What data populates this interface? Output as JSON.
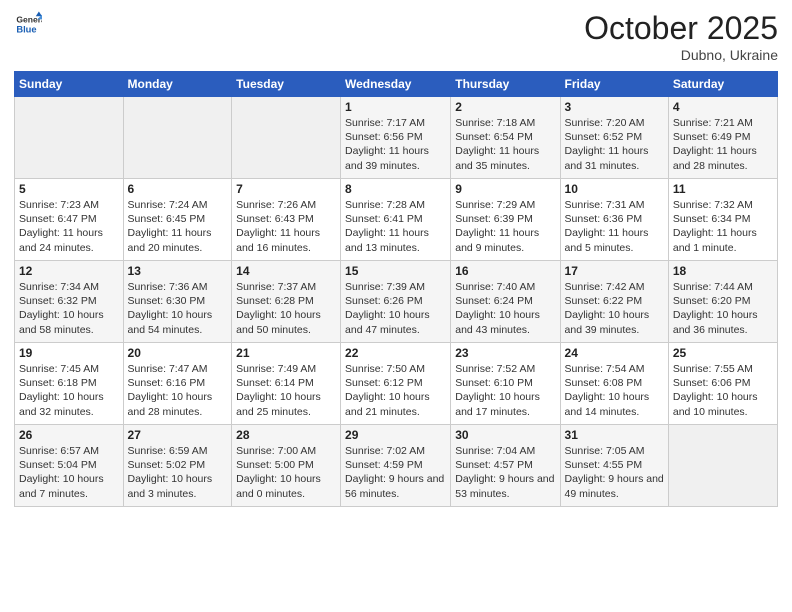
{
  "header": {
    "logo_general": "General",
    "logo_blue": "Blue",
    "month_title": "October 2025",
    "location": "Dubno, Ukraine"
  },
  "days_of_week": [
    "Sunday",
    "Monday",
    "Tuesday",
    "Wednesday",
    "Thursday",
    "Friday",
    "Saturday"
  ],
  "weeks": [
    [
      {
        "day": "",
        "info": ""
      },
      {
        "day": "",
        "info": ""
      },
      {
        "day": "",
        "info": ""
      },
      {
        "day": "1",
        "info": "Sunrise: 7:17 AM\nSunset: 6:56 PM\nDaylight: 11 hours and 39 minutes."
      },
      {
        "day": "2",
        "info": "Sunrise: 7:18 AM\nSunset: 6:54 PM\nDaylight: 11 hours and 35 minutes."
      },
      {
        "day": "3",
        "info": "Sunrise: 7:20 AM\nSunset: 6:52 PM\nDaylight: 11 hours and 31 minutes."
      },
      {
        "day": "4",
        "info": "Sunrise: 7:21 AM\nSunset: 6:49 PM\nDaylight: 11 hours and 28 minutes."
      }
    ],
    [
      {
        "day": "5",
        "info": "Sunrise: 7:23 AM\nSunset: 6:47 PM\nDaylight: 11 hours and 24 minutes."
      },
      {
        "day": "6",
        "info": "Sunrise: 7:24 AM\nSunset: 6:45 PM\nDaylight: 11 hours and 20 minutes."
      },
      {
        "day": "7",
        "info": "Sunrise: 7:26 AM\nSunset: 6:43 PM\nDaylight: 11 hours and 16 minutes."
      },
      {
        "day": "8",
        "info": "Sunrise: 7:28 AM\nSunset: 6:41 PM\nDaylight: 11 hours and 13 minutes."
      },
      {
        "day": "9",
        "info": "Sunrise: 7:29 AM\nSunset: 6:39 PM\nDaylight: 11 hours and 9 minutes."
      },
      {
        "day": "10",
        "info": "Sunrise: 7:31 AM\nSunset: 6:36 PM\nDaylight: 11 hours and 5 minutes."
      },
      {
        "day": "11",
        "info": "Sunrise: 7:32 AM\nSunset: 6:34 PM\nDaylight: 11 hours and 1 minute."
      }
    ],
    [
      {
        "day": "12",
        "info": "Sunrise: 7:34 AM\nSunset: 6:32 PM\nDaylight: 10 hours and 58 minutes."
      },
      {
        "day": "13",
        "info": "Sunrise: 7:36 AM\nSunset: 6:30 PM\nDaylight: 10 hours and 54 minutes."
      },
      {
        "day": "14",
        "info": "Sunrise: 7:37 AM\nSunset: 6:28 PM\nDaylight: 10 hours and 50 minutes."
      },
      {
        "day": "15",
        "info": "Sunrise: 7:39 AM\nSunset: 6:26 PM\nDaylight: 10 hours and 47 minutes."
      },
      {
        "day": "16",
        "info": "Sunrise: 7:40 AM\nSunset: 6:24 PM\nDaylight: 10 hours and 43 minutes."
      },
      {
        "day": "17",
        "info": "Sunrise: 7:42 AM\nSunset: 6:22 PM\nDaylight: 10 hours and 39 minutes."
      },
      {
        "day": "18",
        "info": "Sunrise: 7:44 AM\nSunset: 6:20 PM\nDaylight: 10 hours and 36 minutes."
      }
    ],
    [
      {
        "day": "19",
        "info": "Sunrise: 7:45 AM\nSunset: 6:18 PM\nDaylight: 10 hours and 32 minutes."
      },
      {
        "day": "20",
        "info": "Sunrise: 7:47 AM\nSunset: 6:16 PM\nDaylight: 10 hours and 28 minutes."
      },
      {
        "day": "21",
        "info": "Sunrise: 7:49 AM\nSunset: 6:14 PM\nDaylight: 10 hours and 25 minutes."
      },
      {
        "day": "22",
        "info": "Sunrise: 7:50 AM\nSunset: 6:12 PM\nDaylight: 10 hours and 21 minutes."
      },
      {
        "day": "23",
        "info": "Sunrise: 7:52 AM\nSunset: 6:10 PM\nDaylight: 10 hours and 17 minutes."
      },
      {
        "day": "24",
        "info": "Sunrise: 7:54 AM\nSunset: 6:08 PM\nDaylight: 10 hours and 14 minutes."
      },
      {
        "day": "25",
        "info": "Sunrise: 7:55 AM\nSunset: 6:06 PM\nDaylight: 10 hours and 10 minutes."
      }
    ],
    [
      {
        "day": "26",
        "info": "Sunrise: 6:57 AM\nSunset: 5:04 PM\nDaylight: 10 hours and 7 minutes."
      },
      {
        "day": "27",
        "info": "Sunrise: 6:59 AM\nSunset: 5:02 PM\nDaylight: 10 hours and 3 minutes."
      },
      {
        "day": "28",
        "info": "Sunrise: 7:00 AM\nSunset: 5:00 PM\nDaylight: 10 hours and 0 minutes."
      },
      {
        "day": "29",
        "info": "Sunrise: 7:02 AM\nSunset: 4:59 PM\nDaylight: 9 hours and 56 minutes."
      },
      {
        "day": "30",
        "info": "Sunrise: 7:04 AM\nSunset: 4:57 PM\nDaylight: 9 hours and 53 minutes."
      },
      {
        "day": "31",
        "info": "Sunrise: 7:05 AM\nSunset: 4:55 PM\nDaylight: 9 hours and 49 minutes."
      },
      {
        "day": "",
        "info": ""
      }
    ]
  ]
}
